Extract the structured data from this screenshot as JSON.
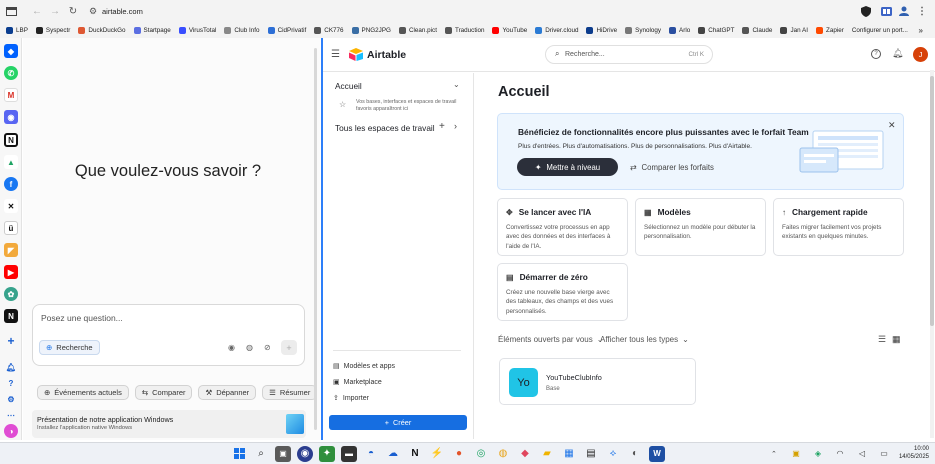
{
  "browser": {
    "url": "airtable.com",
    "bookmarks": [
      {
        "label": "LBP",
        "color": "#0a3d8f"
      },
      {
        "label": "Syspectr",
        "color": "#222222"
      },
      {
        "label": "DuckDuckGo",
        "color": "#de5833"
      },
      {
        "label": "Startpage",
        "color": "#5b6ee1"
      },
      {
        "label": "VirusTotal",
        "color": "#394eff"
      },
      {
        "label": "Club Info",
        "color": "#888888"
      },
      {
        "label": "CidPrivatif",
        "color": "#2d6fd6"
      },
      {
        "label": "CK776",
        "color": "#555555"
      },
      {
        "label": "PNG2JPG",
        "color": "#3a6ea5"
      },
      {
        "label": "Clean.pict",
        "color": "#555555"
      },
      {
        "label": "Traduction",
        "color": "#555555"
      },
      {
        "label": "YouTube",
        "color": "#ff0000"
      },
      {
        "label": "Driver.cloud",
        "color": "#2b7bd4"
      },
      {
        "label": "HiDrive",
        "color": "#0c3c8c"
      },
      {
        "label": "Synology",
        "color": "#777777"
      },
      {
        "label": "Arlo",
        "color": "#2a4fa0"
      },
      {
        "label": "ChatGPT",
        "color": "#444444"
      },
      {
        "label": "Claude",
        "color": "#555555"
      },
      {
        "label": "Jan AI",
        "color": "#444444"
      },
      {
        "label": "Zapier",
        "color": "#ff4a00"
      },
      {
        "label": "Configurer un port..."
      }
    ]
  },
  "copilot": {
    "heading": "Que voulez-vous savoir ?",
    "input_placeholder": "Posez une question...",
    "search_chip": "Recherche",
    "suggestions": [
      "Événements actuels",
      "Comparer",
      "Dépanner",
      "Résumer"
    ],
    "notice_title": "Présentation de notre application Windows",
    "notice_sub": "Installez l'application native Windows"
  },
  "airtable": {
    "logo_text": "Airtable",
    "search_placeholder": "Recherche...",
    "search_shortcut": "Ctrl K",
    "user_initial": "J",
    "nav": {
      "home": "Accueil",
      "home_hint": "Vos bases, interfaces et espaces de travail favoris apparaîtront ici",
      "workspaces": "Tous les espaces de travail",
      "templates": "Modèles et apps",
      "marketplace": "Marketplace",
      "import": "Importer",
      "create": "Créer"
    },
    "page_title": "Accueil",
    "promo": {
      "title": "Bénéficiez de fonctionnalités encore plus puissantes avec le forfait Team",
      "desc": "Plus d'entrées. Plus d'automatisations. Plus de personnalisations. Plus d'Airtable.",
      "upgrade": "Mettre à niveau",
      "compare": "Comparer les forfaits"
    },
    "cards": [
      {
        "title": "Se lancer avec l'IA",
        "icon": "ai-sparkle-icon",
        "desc": "Convertissez votre processus en app avec des données et des interfaces à l'aide de l'IA."
      },
      {
        "title": "Modèles",
        "icon": "grid-icon",
        "desc": "Sélectionnez un modèle pour débuter la personnalisation."
      },
      {
        "title": "Chargement rapide",
        "icon": "upload-arrow-icon",
        "desc": "Faites migrer facilement vos projets existants en quelques minutes."
      },
      {
        "title": "Démarrer de zéro",
        "icon": "table-icon",
        "desc": "Créez une nouvelle base vierge avec des tableaux, des champs et des vues personnalisés."
      }
    ],
    "filter_recent": "Éléments ouverts par vous",
    "filter_types": "Afficher tous les types",
    "base": {
      "initials": "Yo",
      "name": "YouTubeClubInfo",
      "type": "Base",
      "color": "#20c4e6"
    }
  },
  "taskbar": {
    "time": "10:00",
    "date": "14/05/2025"
  },
  "colors": {
    "accent": "#2d7ff9",
    "dark_button": "#2b2f3a",
    "promo_bg": "#eef6fe"
  }
}
